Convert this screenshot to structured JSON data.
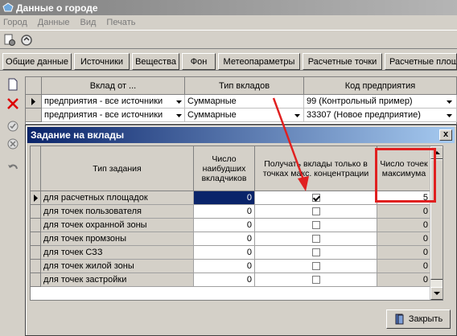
{
  "window": {
    "title": "Данные о городе"
  },
  "menu": [
    "Город",
    "Данные",
    "Вид",
    "Печать"
  ],
  "tabs": [
    "Общие данные",
    "Источники",
    "Вещества",
    "Фон",
    "Метеопараметры",
    "Расчетные точки",
    "Расчетные площ"
  ],
  "contribution_grid": {
    "columns": [
      "Вклад от ...",
      "Тип вкладов",
      "Код предприятия"
    ],
    "rows": [
      {
        "source": "предприятия - все источники",
        "type": "Суммарные",
        "code": "99 (Контрольный пример)"
      },
      {
        "source": "предприятия - все источники",
        "type": "Суммарные",
        "code": "33307 (Новое предприятие)"
      }
    ]
  },
  "dialog": {
    "title": "Задание на вклады",
    "close_glyph": "x",
    "columns": {
      "task_type": "Тип задания",
      "contributors": "Число наибудших вкладчиков",
      "max_only": "Получать вклады только в точках макс. концентрации",
      "max_points": "Число точек максимума"
    },
    "rows": [
      {
        "name": "для расчетных площадок",
        "contributors": "0",
        "max_only": true,
        "max_points": "5"
      },
      {
        "name": "для точек пользователя",
        "contributors": "0",
        "max_only": false,
        "max_points": "0"
      },
      {
        "name": "для точек охранной зоны",
        "contributors": "0",
        "max_only": false,
        "max_points": "0"
      },
      {
        "name": "для точек промзоны",
        "contributors": "0",
        "max_only": false,
        "max_points": "0"
      },
      {
        "name": "для точек СЗЗ",
        "contributors": "0",
        "max_only": false,
        "max_points": "0"
      },
      {
        "name": "для точек жилой зоны",
        "contributors": "0",
        "max_only": false,
        "max_points": "0"
      },
      {
        "name": "для точек застройки",
        "contributors": "0",
        "max_only": false,
        "max_points": "0"
      }
    ],
    "close_button": "Закрыть"
  },
  "colors": {
    "annotation": "#e02020",
    "selection": "#0a246a"
  }
}
